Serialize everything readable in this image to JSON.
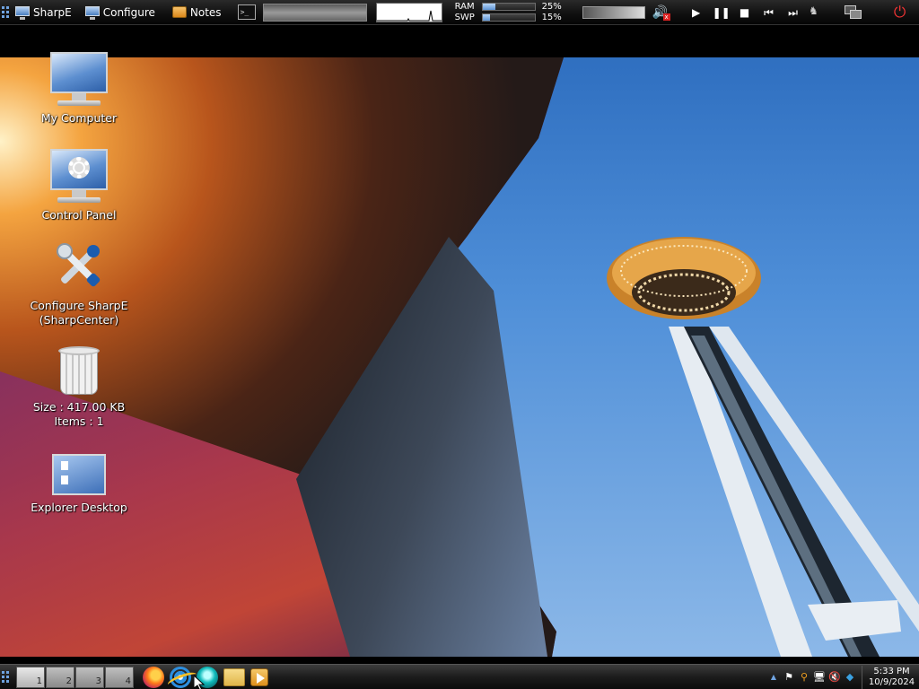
{
  "topbar": {
    "sharpe_label": "SharpE",
    "configure_label": "Configure",
    "notes_label": "Notes",
    "terminal_glyph": ">_",
    "ram_label": "RAM",
    "ram_value": "25%",
    "ram_fraction": 0.25,
    "swp_label": "SWP",
    "swp_value": "15%",
    "swp_fraction": 0.15
  },
  "desktop": {
    "icons": [
      {
        "label": "My Computer"
      },
      {
        "label": "Control Panel"
      },
      {
        "label": "Configure SharpE",
        "label2": "(SharpCenter)"
      },
      {
        "label": "Size : 417.00 KB",
        "label2": "Items : 1"
      },
      {
        "label": "Explorer Desktop"
      }
    ]
  },
  "taskbar": {
    "pages": [
      "1",
      "2",
      "3",
      "4"
    ],
    "clock_time": "5:33 PM",
    "clock_date": "10/9/2024"
  },
  "colors": {
    "accent": "#6fa3e0",
    "meter_fill": "#5d93d3",
    "power": "#e33333"
  }
}
